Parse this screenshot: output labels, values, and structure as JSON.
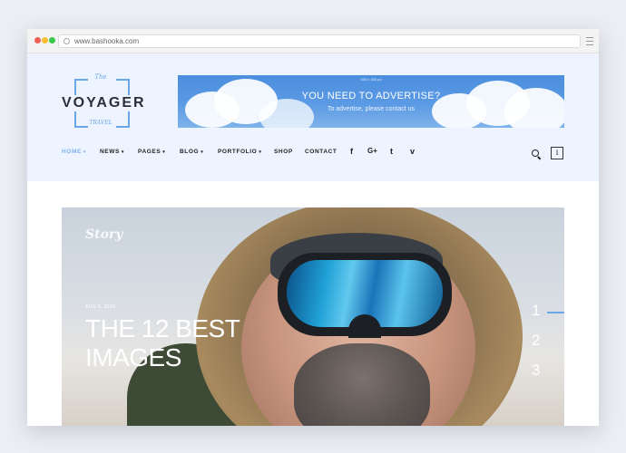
{
  "browser": {
    "url": "www.bashooka.com"
  },
  "logo": {
    "the": "The",
    "name": "VOYAGER",
    "travel": "TRAVEL"
  },
  "ad": {
    "small": "000 x 000 px",
    "title": "YOU NEED TO ADVERTISE?",
    "subtitle": "To advertise, please contact us"
  },
  "nav": {
    "items": [
      {
        "label": "HOME",
        "active": true
      },
      {
        "label": "NEWS"
      },
      {
        "label": "PAGES"
      },
      {
        "label": "BLOG"
      },
      {
        "label": "PORTFOLIO"
      },
      {
        "label": "SHOP"
      },
      {
        "label": "CONTACT"
      }
    ],
    "social": {
      "facebook": "f",
      "google": "G+",
      "twitter": "t",
      "vimeo": "v"
    },
    "info": "i"
  },
  "hero": {
    "category": "Story",
    "date": "AUG 6, 2016",
    "title": "THE 12 BEST IMAGES",
    "slides": [
      "1",
      "2",
      "3"
    ],
    "active_slide": 1
  },
  "colors": {
    "accent": "#6aa6e8",
    "header_bg": "#edf4ff"
  }
}
